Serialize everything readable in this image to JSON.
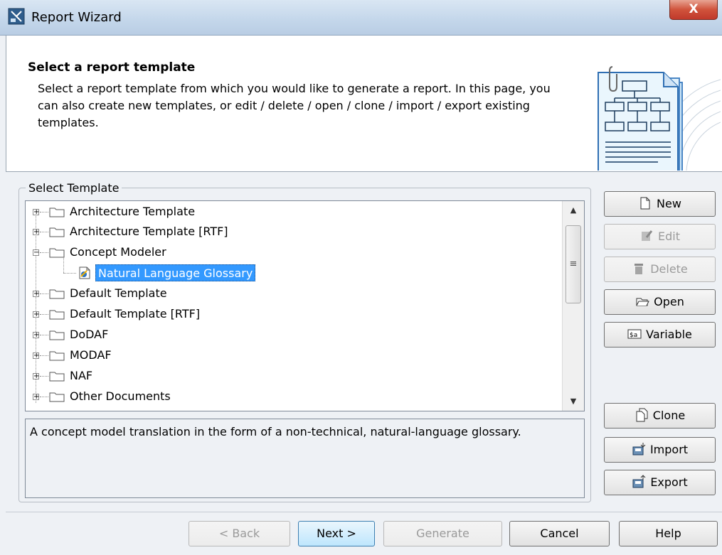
{
  "window": {
    "title": "Report Wizard",
    "close_label": "X"
  },
  "header": {
    "title": "Select a report template",
    "description": "Select a report template from which you would like to generate a report. In this page, you can also create new templates, or edit / delete / open / clone / import / export existing templates."
  },
  "template_panel": {
    "legend": "Select Template",
    "items": [
      {
        "label": "Architecture Template",
        "expanded": false
      },
      {
        "label": "Architecture Template [RTF]",
        "expanded": false
      },
      {
        "label": "Concept Modeler",
        "expanded": true
      },
      {
        "label": "Natural Language Glossary",
        "selected": true
      },
      {
        "label": "Default Template",
        "expanded": false
      },
      {
        "label": "Default Template [RTF]",
        "expanded": false
      },
      {
        "label": "DoDAF",
        "expanded": false
      },
      {
        "label": "MODAF",
        "expanded": false
      },
      {
        "label": "NAF",
        "expanded": false
      },
      {
        "label": "Other Documents",
        "expanded": false
      }
    ],
    "description": "A concept model translation in the form of a non-technical, natural-language glossary."
  },
  "side_buttons": {
    "new": "New",
    "edit": "Edit",
    "delete": "Delete",
    "open": "Open",
    "variable": "Variable",
    "clone": "Clone",
    "import": "Import",
    "export": "Export"
  },
  "footer_buttons": {
    "back": "< Back",
    "next": "Next >",
    "generate": "Generate",
    "cancel": "Cancel",
    "help": "Help"
  },
  "icons": {
    "app": "report-wizard-icon",
    "folder": "folder-icon",
    "template": "template-file-icon",
    "new": "new-document-icon",
    "edit": "edit-icon",
    "delete": "trash-icon",
    "open": "open-folder-icon",
    "variable": "variable-icon",
    "clone": "clone-icon",
    "import": "import-icon",
    "export": "export-icon"
  },
  "colors": {
    "selection": "#3399ff",
    "close_button": "#c0392b",
    "background": "#eef1f5"
  }
}
